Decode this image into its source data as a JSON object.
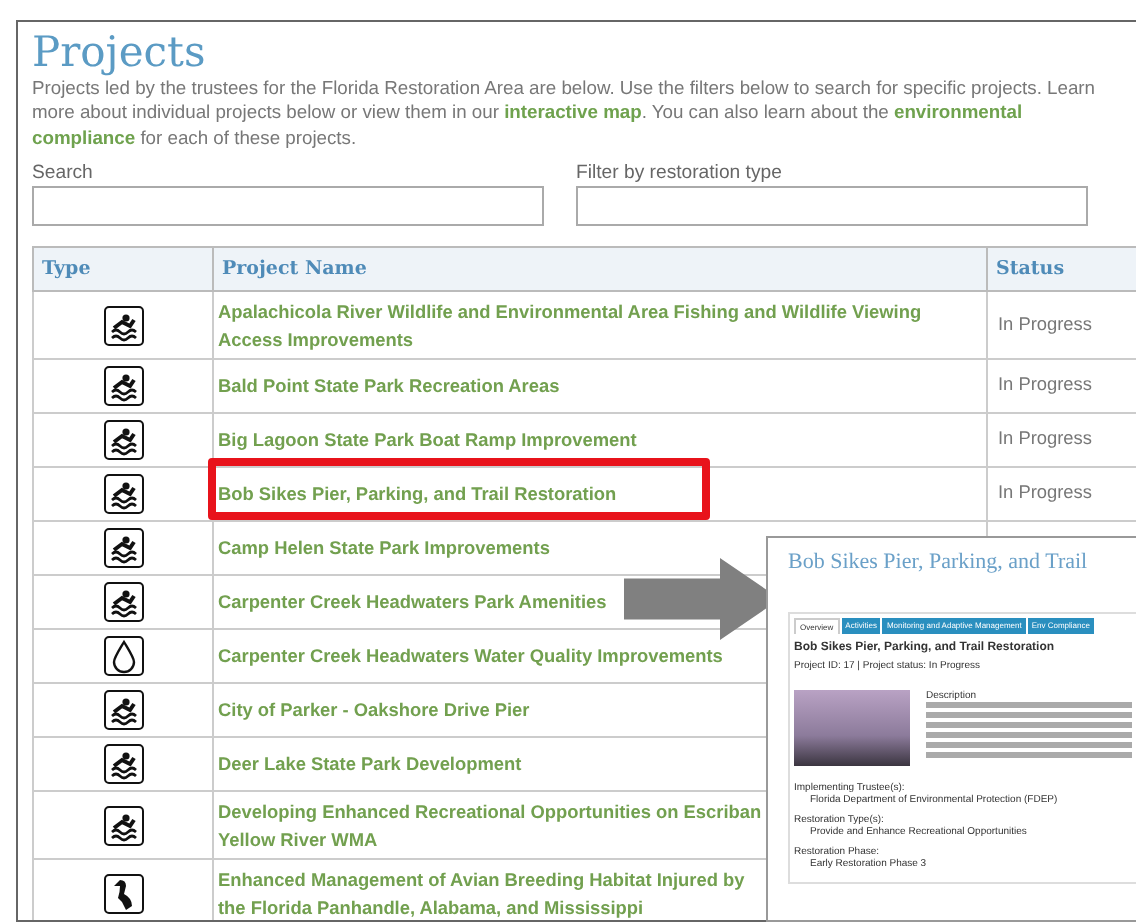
{
  "page": {
    "title": "Projects",
    "intro": "Projects led by the trustees for the Florida Restoration Area are below. Use the filters below to search for specific projects. Learn more about individual projects below or view them in our **interactive map**. You can also learn about the **environmental compliance** for each of these projects."
  },
  "filters": [
    {
      "label": "Search"
    },
    {
      "label": "Filter by restoration type"
    }
  ],
  "table": {
    "columns": [
      "Type",
      "Project Name",
      "Status"
    ],
    "rows": [
      {
        "kind": "recreation",
        "lines": [
          "Apalachicola River Wildlife and Environmental Area Fishing and Wildlife Viewing",
          "Access Improvements"
        ],
        "status": "In Progress",
        "highlighted": false
      },
      {
        "kind": "recreation",
        "lines": [
          "Bald Point State Park Recreation Areas"
        ],
        "status": "In Progress",
        "highlighted": false
      },
      {
        "kind": "recreation",
        "lines": [
          "Big Lagoon State Park Boat Ramp Improvement"
        ],
        "status": "In Progress",
        "highlighted": false
      },
      {
        "kind": "recreation",
        "lines": [
          "Bob Sikes Pier, Parking, and Trail Restoration"
        ],
        "status": "In Progress",
        "highlighted": true
      },
      {
        "kind": "recreation",
        "lines": [
          "Camp Helen State Park Improvements"
        ],
        "highlighted": false
      },
      {
        "kind": "recreation",
        "lines": [
          "Carpenter Creek Headwaters Park Amenities"
        ],
        "highlighted": false
      },
      {
        "kind": "water",
        "lines": [
          "Carpenter Creek Headwaters Water Quality Improvements"
        ],
        "highlighted": false
      },
      {
        "kind": "recreation",
        "lines": [
          "City of Parker - Oakshore Drive Pier"
        ],
        "highlighted": false
      },
      {
        "kind": "recreation",
        "lines": [
          "Deer Lake State Park Development"
        ],
        "highlighted": false
      },
      {
        "kind": "recreation",
        "lines": [
          "Developing Enhanced Recreational Opportunities on Escriban",
          "Yellow River WMA"
        ],
        "highlighted": false
      },
      {
        "kind": "bird",
        "lines": [
          "Enhanced Management of Avian Breeding Habitat Injured by",
          "the Florida Panhandle, Alabama, and Mississippi"
        ],
        "highlighted": false
      }
    ]
  },
  "preview": {
    "title": "Bob Sikes Pier, Parking, and Trail",
    "tabs": [
      {
        "label": "Overview",
        "selected": true
      },
      {
        "label": "Activities",
        "selected": false
      },
      {
        "label": "Monitoring and Adaptive Management",
        "selected": false
      },
      {
        "label": "Env Compliance",
        "selected": false
      }
    ],
    "heading": "Bob Sikes Pier, Parking, and Trail Restoration",
    "meta": "Project ID: 17 | Project status: In Progress",
    "description_label": "Description",
    "sections": [
      {
        "label": "Implementing Trustee(s):",
        "value": "Florida Department of Environmental Protection (FDEP)"
      },
      {
        "label": "Restoration Type(s):",
        "value": "Provide and Enhance Recreational Opportunities"
      },
      {
        "label": "Restoration Phase:",
        "value": "Early Restoration Phase 3"
      }
    ]
  }
}
